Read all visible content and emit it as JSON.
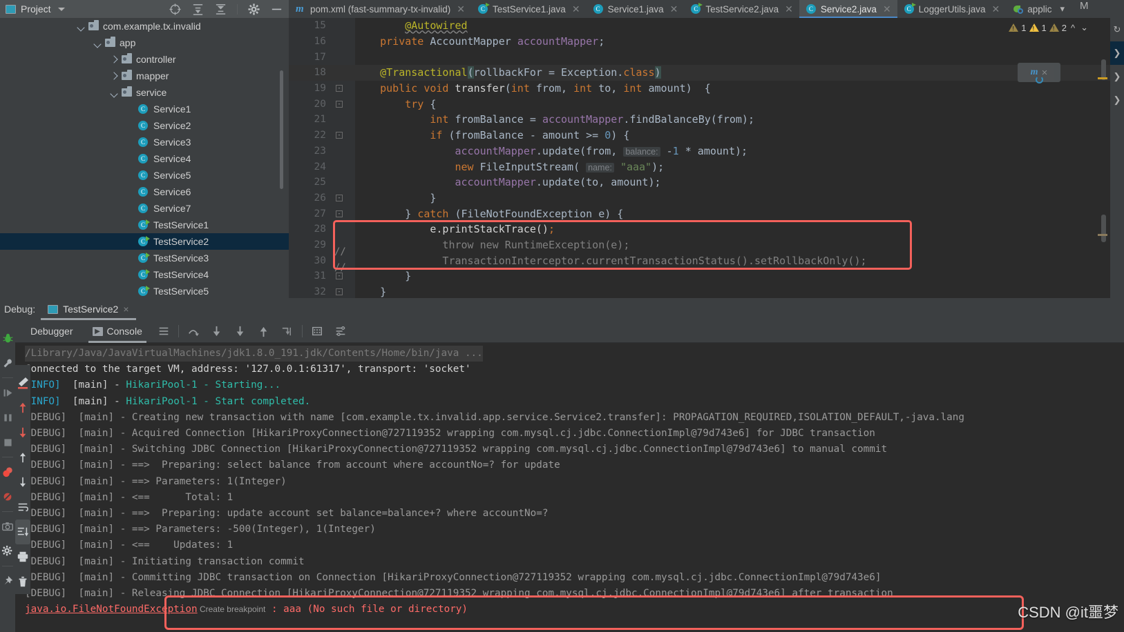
{
  "project_panel": {
    "title": "Project",
    "icons": [
      "locate-icon",
      "expand-all-icon",
      "collapse-all-icon",
      "settings-gear-icon",
      "minimize-icon"
    ],
    "tree": [
      {
        "label": "com.example.tx.invalid",
        "type": "package",
        "indent": 0,
        "arrow": "down",
        "selected": false
      },
      {
        "label": "app",
        "type": "package",
        "indent": 1,
        "arrow": "down",
        "selected": false
      },
      {
        "label": "controller",
        "type": "package",
        "indent": 2,
        "arrow": "right",
        "selected": false
      },
      {
        "label": "mapper",
        "type": "package",
        "indent": 2,
        "arrow": "right",
        "selected": false
      },
      {
        "label": "service",
        "type": "package",
        "indent": 2,
        "arrow": "down",
        "selected": false
      },
      {
        "label": "Service1",
        "type": "class",
        "indent": 3,
        "arrow": "",
        "selected": false
      },
      {
        "label": "Service2",
        "type": "class",
        "indent": 3,
        "arrow": "",
        "selected": false
      },
      {
        "label": "Service3",
        "type": "class",
        "indent": 3,
        "arrow": "",
        "selected": false
      },
      {
        "label": "Service4",
        "type": "class",
        "indent": 3,
        "arrow": "",
        "selected": false
      },
      {
        "label": "Service5",
        "type": "class",
        "indent": 3,
        "arrow": "",
        "selected": false
      },
      {
        "label": "Service6",
        "type": "class",
        "indent": 3,
        "arrow": "",
        "selected": false
      },
      {
        "label": "Service7",
        "type": "class",
        "indent": 3,
        "arrow": "",
        "selected": false
      },
      {
        "label": "TestService1",
        "type": "runnable-class",
        "indent": 3,
        "arrow": "",
        "selected": false
      },
      {
        "label": "TestService2",
        "type": "runnable-class",
        "indent": 3,
        "arrow": "",
        "selected": true
      },
      {
        "label": "TestService3",
        "type": "runnable-class",
        "indent": 3,
        "arrow": "",
        "selected": false
      },
      {
        "label": "TestService4",
        "type": "runnable-class",
        "indent": 3,
        "arrow": "",
        "selected": false
      },
      {
        "label": "TestService5",
        "type": "runnable-class",
        "indent": 3,
        "arrow": "",
        "selected": false
      }
    ]
  },
  "editor_tabs": [
    {
      "label": "pom.xml (fast-summary-tx-invalid)",
      "icon": "maven-icon",
      "active": false
    },
    {
      "label": "TestService1.java",
      "icon": "runnable-class-icon",
      "active": false
    },
    {
      "label": "Service1.java",
      "icon": "class-icon",
      "active": false
    },
    {
      "label": "TestService2.java",
      "icon": "runnable-class-icon",
      "active": false
    },
    {
      "label": "Service2.java",
      "icon": "class-icon",
      "active": true
    },
    {
      "label": "LoggerUtils.java",
      "icon": "runnable-class-icon",
      "active": false
    },
    {
      "label": "applic",
      "icon": "spring-config-icon",
      "active": false
    }
  ],
  "editor_tabs_overflow": "M",
  "inspections": {
    "grey_warning_count": "1",
    "yellow_warning_count": "1",
    "dark_warning_count": "2",
    "prev_icon": "chevron-up-icon",
    "next_icon": "chevron-down-icon"
  },
  "floating_widget": {
    "icon": "maven-reload-icon",
    "close": "×"
  },
  "code_lines": [
    {
      "num": "15",
      "fold": "",
      "current": false,
      "tokens": [
        {
          "t": "        ",
          "c": ""
        },
        {
          "t": "@Autowired",
          "c": "ann squig"
        }
      ]
    },
    {
      "num": "16",
      "fold": "",
      "current": false,
      "tokens": [
        {
          "t": "    ",
          "c": ""
        },
        {
          "t": "private ",
          "c": "kw"
        },
        {
          "t": "AccountMapper ",
          "c": "type"
        },
        {
          "t": "accountMapper",
          "c": "fld"
        },
        {
          "t": ";",
          "c": ""
        }
      ]
    },
    {
      "num": "17",
      "fold": "",
      "current": false,
      "tokens": []
    },
    {
      "num": "18",
      "fold": "",
      "current": true,
      "tokens": [
        {
          "t": "    ",
          "c": ""
        },
        {
          "t": "@Transactional",
          "c": "ann"
        },
        {
          "t": "(",
          "c": "brmatch"
        },
        {
          "t": "rollbackFor = Exception.",
          "c": ""
        },
        {
          "t": "class",
          "c": "kw"
        },
        {
          "t": ")",
          "c": "brmatch"
        }
      ]
    },
    {
      "num": "19",
      "fold": "minus",
      "current": false,
      "tokens": [
        {
          "t": "    ",
          "c": ""
        },
        {
          "t": "public void ",
          "c": "kw"
        },
        {
          "t": "transfer",
          "c": "c-white"
        },
        {
          "t": "(",
          "c": ""
        },
        {
          "t": "int ",
          "c": "kw"
        },
        {
          "t": "from, ",
          "c": ""
        },
        {
          "t": "int ",
          "c": "kw"
        },
        {
          "t": "to, ",
          "c": ""
        },
        {
          "t": "int ",
          "c": "kw"
        },
        {
          "t": "amount)  {",
          "c": ""
        }
      ]
    },
    {
      "num": "20",
      "fold": "minus",
      "current": false,
      "tokens": [
        {
          "t": "        ",
          "c": ""
        },
        {
          "t": "try ",
          "c": "kw"
        },
        {
          "t": "{",
          "c": ""
        }
      ]
    },
    {
      "num": "21",
      "fold": "",
      "current": false,
      "tokens": [
        {
          "t": "            ",
          "c": ""
        },
        {
          "t": "int ",
          "c": "kw"
        },
        {
          "t": "fromBalance = ",
          "c": ""
        },
        {
          "t": "accountMapper",
          "c": "fld"
        },
        {
          "t": ".findBalanceBy(from);",
          "c": ""
        }
      ]
    },
    {
      "num": "22",
      "fold": "minus",
      "current": false,
      "tokens": [
        {
          "t": "            ",
          "c": ""
        },
        {
          "t": "if ",
          "c": "kw"
        },
        {
          "t": "(fromBalance - amount >= ",
          "c": ""
        },
        {
          "t": "0",
          "c": "num"
        },
        {
          "t": ") {",
          "c": ""
        }
      ]
    },
    {
      "num": "23",
      "fold": "",
      "current": false,
      "tokens": [
        {
          "t": "                ",
          "c": ""
        },
        {
          "t": "accountMapper",
          "c": "fld"
        },
        {
          "t": ".update(from, ",
          "c": ""
        },
        {
          "t": "balance:",
          "c": "hint"
        },
        {
          "t": " -",
          "c": ""
        },
        {
          "t": "1",
          "c": "num"
        },
        {
          "t": " * amount);",
          "c": ""
        }
      ]
    },
    {
      "num": "24",
      "fold": "",
      "current": false,
      "tokens": [
        {
          "t": "                ",
          "c": ""
        },
        {
          "t": "new ",
          "c": "kw"
        },
        {
          "t": "FileInputStream( ",
          "c": ""
        },
        {
          "t": "name:",
          "c": "hint"
        },
        {
          "t": " ",
          "c": ""
        },
        {
          "t": "\"aaa\"",
          "c": "str"
        },
        {
          "t": ");",
          "c": ""
        }
      ]
    },
    {
      "num": "25",
      "fold": "",
      "current": false,
      "tokens": [
        {
          "t": "                ",
          "c": ""
        },
        {
          "t": "accountMapper",
          "c": "fld"
        },
        {
          "t": ".update(to, amount);",
          "c": ""
        }
      ]
    },
    {
      "num": "26",
      "fold": "minus-end",
      "current": false,
      "tokens": [
        {
          "t": "            }",
          "c": ""
        }
      ]
    },
    {
      "num": "27",
      "fold": "minus",
      "current": false,
      "tokens": [
        {
          "t": "        } ",
          "c": ""
        },
        {
          "t": "catch ",
          "c": "kw"
        },
        {
          "t": "(FileNotFoundException e) {",
          "c": ""
        }
      ]
    },
    {
      "num": "28",
      "fold": "",
      "current": false,
      "tokens": [
        {
          "t": "            e.printStackTrace",
          "c": "c-white"
        },
        {
          "t": "()",
          "c": "c-white"
        },
        {
          "t": ";",
          "c": "kw"
        }
      ]
    },
    {
      "num": "29",
      "fold": "comment",
      "current": false,
      "tokens": [
        {
          "t": "              throw new RuntimeException(e);",
          "c": "cmt"
        }
      ]
    },
    {
      "num": "30",
      "fold": "comment",
      "current": false,
      "tokens": [
        {
          "t": "              TransactionInterceptor.currentTransactionStatus().setRollbackOnly();",
          "c": "cmt"
        }
      ]
    },
    {
      "num": "31",
      "fold": "minus-end",
      "current": false,
      "tokens": [
        {
          "t": "        }",
          "c": ""
        }
      ]
    },
    {
      "num": "32",
      "fold": "minus-end",
      "current": false,
      "tokens": [
        {
          "t": "    }",
          "c": ""
        }
      ]
    }
  ],
  "debug": {
    "label": "Debug:",
    "session_tab": "TestService2",
    "close_icon": "×",
    "tabs": [
      {
        "label": "Debugger",
        "icon": "",
        "active": false
      },
      {
        "label": "Console",
        "icon": "console-icon",
        "active": true
      }
    ],
    "toolbar_icons": [
      "soft-wrap-icon",
      "step-over-icon",
      "step-into-icon",
      "force-step-into-icon",
      "step-out-icon",
      "run-to-cursor-icon",
      "evaluate-icon",
      "settings-icon"
    ],
    "left_rail_icons": [
      "debug-bug-icon",
      "wrench-icon",
      "resume-icon",
      "pause-icon",
      "stop-icon",
      "view-breakpoints-icon",
      "mute-breakpoints-icon",
      "screenshot-icon",
      "settings-gear-icon",
      "pin-icon"
    ],
    "console_rail_icons": [
      "highlight-icon",
      "up-red-arrow-icon",
      "down-red-arrow-icon",
      "up-arrow-icon",
      "down-arrow-icon",
      "soft-wrap-icon",
      "scroll-to-end-icon",
      "print-icon",
      "trash-icon"
    ]
  },
  "console_lines": [
    {
      "segments": [
        {
          "t": "/Library/Java/JavaVirtualMachines/jdk1.8.0_191.jdk/Contents/Home/bin/java ...",
          "c": "c-cmd"
        }
      ]
    },
    {
      "segments": [
        {
          "t": "Connected to the target VM, address: '127.0.0.1:61317', transport: 'socket'",
          "c": "c-white"
        }
      ]
    },
    {
      "segments": [
        {
          "t": "[INFO]",
          "c": "c-info"
        },
        {
          "t": "  ",
          "c": ""
        },
        {
          "t": "[main]",
          "c": "c-main"
        },
        {
          "t": " - ",
          "c": "c-dash"
        },
        {
          "t": "HikariPool-1 - Starting...",
          "c": "c-teal"
        }
      ]
    },
    {
      "segments": [
        {
          "t": "[INFO]",
          "c": "c-info"
        },
        {
          "t": "  ",
          "c": ""
        },
        {
          "t": "[main]",
          "c": "c-main"
        },
        {
          "t": " - ",
          "c": "c-dash"
        },
        {
          "t": "HikariPool-1 - Start completed.",
          "c": "c-teal"
        }
      ]
    },
    {
      "segments": [
        {
          "t": "[DEBUG]  [main] - Creating new transaction with name [com.example.tx.invalid.app.service.Service2.transfer]: PROPAGATION_REQUIRED,ISOLATION_DEFAULT,-java.lang",
          "c": "c-debug"
        }
      ]
    },
    {
      "segments": [
        {
          "t": "[DEBUG]  [main] - Acquired Connection [HikariProxyConnection@727119352 wrapping com.mysql.cj.jdbc.ConnectionImpl@79d743e6] for JDBC transaction",
          "c": "c-debug"
        }
      ]
    },
    {
      "segments": [
        {
          "t": "[DEBUG]  [main] - Switching JDBC Connection [HikariProxyConnection@727119352 wrapping com.mysql.cj.jdbc.ConnectionImpl@79d743e6] to manual commit",
          "c": "c-debug"
        }
      ]
    },
    {
      "segments": [
        {
          "t": "[DEBUG]  [main] - ==>  Preparing: select balance from account where accountNo=? for update",
          "c": "c-debug"
        }
      ]
    },
    {
      "segments": [
        {
          "t": "[DEBUG]  [main] - ==> Parameters: 1(Integer)",
          "c": "c-debug"
        }
      ]
    },
    {
      "segments": [
        {
          "t": "[DEBUG]  [main] - <==      Total: 1",
          "c": "c-debug"
        }
      ]
    },
    {
      "segments": [
        {
          "t": "[DEBUG]  [main] - ==>  Preparing: update account set balance=balance+? where accountNo=?",
          "c": "c-debug"
        }
      ]
    },
    {
      "segments": [
        {
          "t": "[DEBUG]  [main] - ==> Parameters: -500(Integer), 1(Integer)",
          "c": "c-debug"
        }
      ]
    },
    {
      "segments": [
        {
          "t": "[DEBUG]  [main] - <==    Updates: 1",
          "c": "c-debug"
        }
      ]
    },
    {
      "segments": [
        {
          "t": "[DEBUG]  [main] - Initiating transaction commit",
          "c": "c-debug"
        }
      ]
    },
    {
      "segments": [
        {
          "t": "[DEBUG]  [main] - Committing JDBC transaction on Connection [HikariProxyConnection@727119352 wrapping com.mysql.cj.jdbc.ConnectionImpl@79d743e6]",
          "c": "c-debug"
        }
      ]
    },
    {
      "segments": [
        {
          "t": "[DEBUG]  [main] - Releasing JDBC Connection [HikariProxyConnection@727119352 wrapping com.mysql.cj.jdbc.ConnectionImpl@79d743e6] after transaction",
          "c": "c-debug"
        }
      ]
    },
    {
      "segments": [
        {
          "t": "java.io.FileNotFoundException",
          "c": "c-errlink"
        },
        {
          "t": " Create breakpoint",
          "c": "c-bp"
        },
        {
          "t": " : aaa (No such file or directory)",
          "c": "c-err"
        }
      ]
    }
  ],
  "watermark": "CSDN @it噩梦",
  "colors": {
    "accent_blue": "#4a88c7",
    "selection_blue": "#0d293e",
    "highlight_red": "#f4615b",
    "editor_bg": "#2b2b2b",
    "panel_bg": "#3c3f41",
    "info_cyan": "#2ba8cf",
    "teal": "#2fbdaa"
  }
}
